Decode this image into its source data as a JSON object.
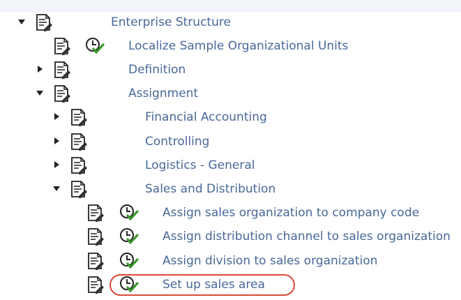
{
  "tree": {
    "root": {
      "label": "Enterprise Structure",
      "expanded": true
    },
    "items": [
      {
        "label": "Localize Sample Organizational Units",
        "has_execute": true
      },
      {
        "label": "Definition",
        "expanded": false
      },
      {
        "label": "Assignment",
        "expanded": true
      },
      {
        "label": "Financial Accounting",
        "expanded": false
      },
      {
        "label": "Controlling",
        "expanded": false
      },
      {
        "label": "Logistics - General",
        "expanded": false
      },
      {
        "label": "Sales and Distribution",
        "expanded": true
      },
      {
        "label": "Assign sales organization to company code",
        "has_execute": true
      },
      {
        "label": "Assign distribution channel to sales organization",
        "has_execute": true
      },
      {
        "label": "Assign division to sales organization",
        "has_execute": true
      },
      {
        "label": "Set up sales area",
        "has_execute": true,
        "highlighted": true
      }
    ]
  },
  "colors": {
    "label_text": "#48689a",
    "highlight_border": "#d94a38",
    "execute_check": "#3a9a2a"
  }
}
